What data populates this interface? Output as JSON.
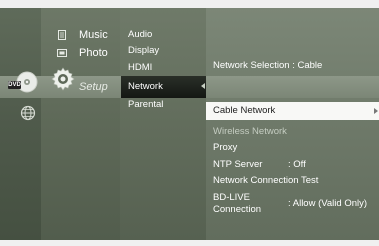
{
  "media_menu": {
    "music_label": "Music",
    "photo_label": "Photo",
    "setup_label": "Setup"
  },
  "icons": {
    "disc_tag": "DVD"
  },
  "setup_submenu": {
    "items": [
      "Audio",
      "Display",
      "HDMI",
      "Network",
      "Parental"
    ],
    "active": "Network"
  },
  "network_panel": {
    "selection_label": "Network Selection",
    "selection_value": ": Cable",
    "highlighted": "Cable Network",
    "wireless": "Wireless Network",
    "proxy": "Proxy",
    "ntp_label": "NTP Server",
    "ntp_value": ": Off",
    "test": "Network Connection Test",
    "bdlive_label_1": "BD-LIVE",
    "bdlive_label_2": "Connection",
    "bdlive_value": ": Allow (Valid Only)"
  }
}
